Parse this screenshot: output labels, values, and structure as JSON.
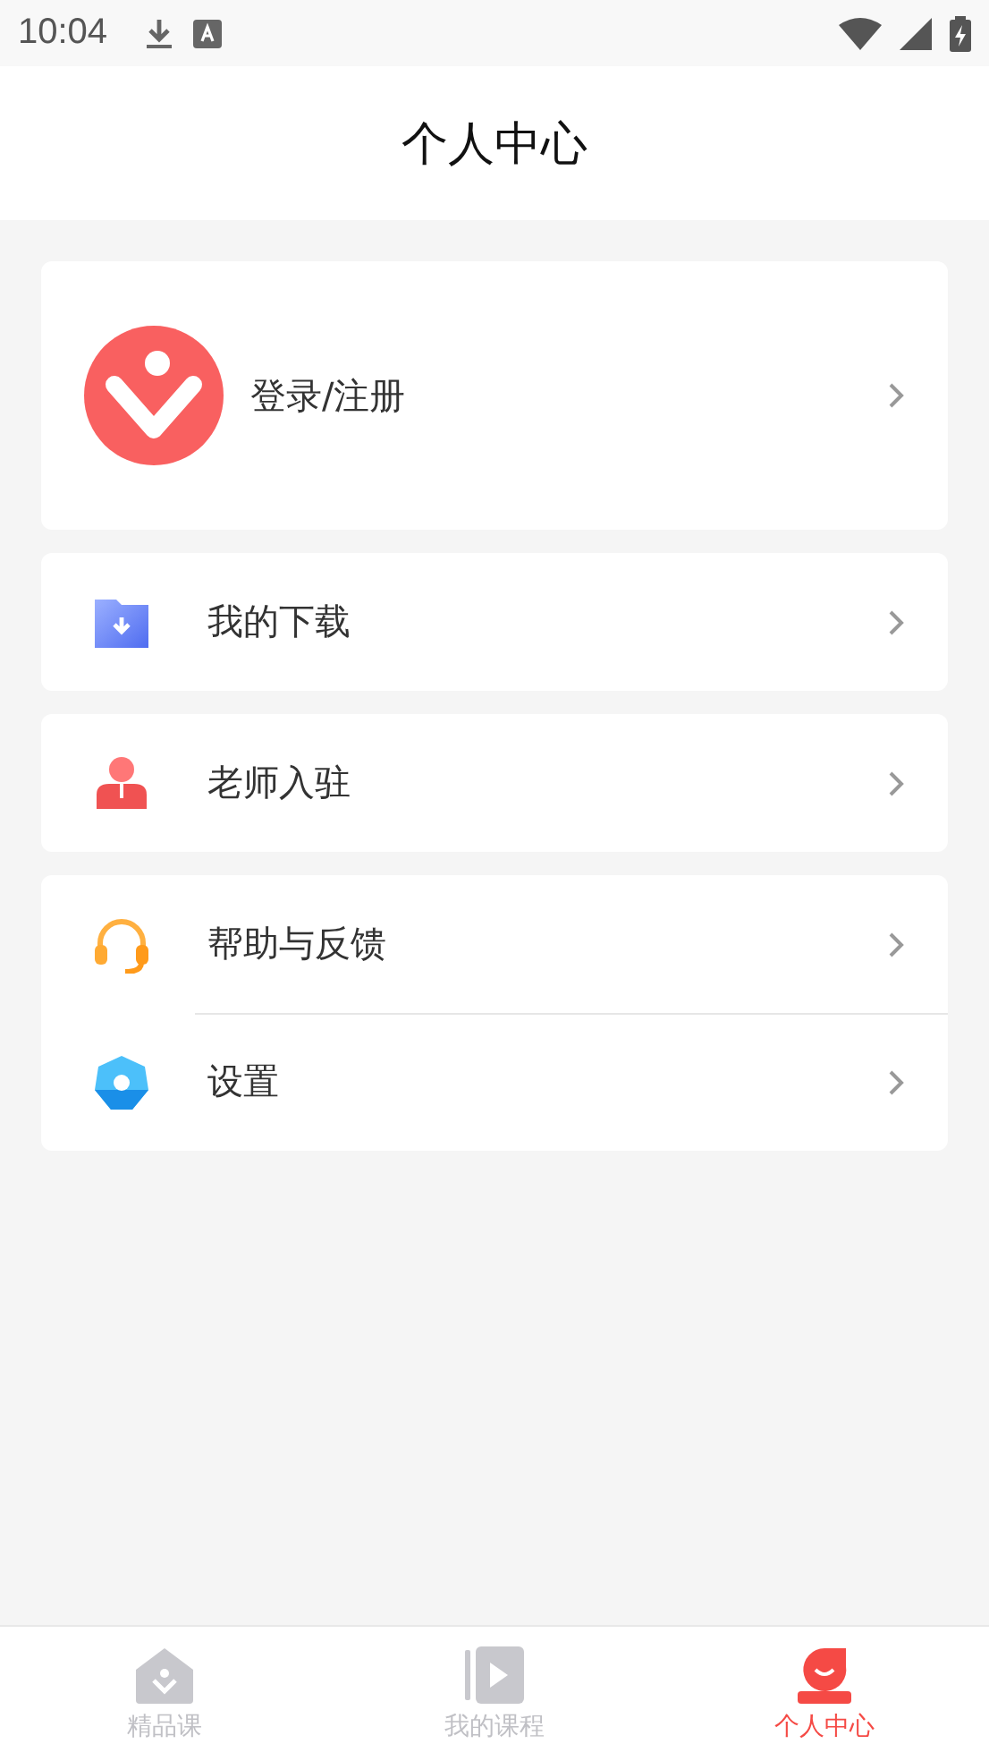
{
  "status_bar": {
    "time": "10:04"
  },
  "header": {
    "title": "个人中心"
  },
  "login": {
    "label": "登录/注册"
  },
  "menu_groups": [
    {
      "items": [
        {
          "kind": "download",
          "label": "我的下载"
        }
      ]
    },
    {
      "items": [
        {
          "kind": "teacher",
          "label": "老师入驻"
        }
      ]
    },
    {
      "items": [
        {
          "kind": "help",
          "label": "帮助与反馈"
        },
        {
          "kind": "settings",
          "label": "设置"
        }
      ]
    }
  ],
  "tabs": [
    {
      "kind": "home",
      "label": "精品课",
      "selected": false
    },
    {
      "kind": "courses",
      "label": "我的课程",
      "selected": false
    },
    {
      "kind": "profile",
      "label": "个人中心",
      "selected": true
    }
  ]
}
